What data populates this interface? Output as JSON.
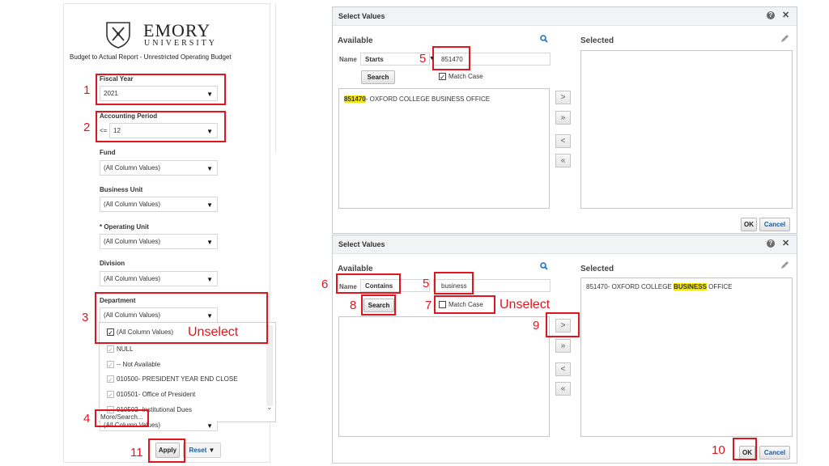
{
  "left": {
    "logo_name": "EMORY",
    "logo_sub": "UNIVERSITY",
    "report_title": "Budget to Actual Report - Unrestricted Operating Budget",
    "fiscal_year": {
      "label": "Fiscal Year",
      "value": "2021"
    },
    "accounting_period": {
      "label": "Accounting Period",
      "op": "<=",
      "value": "12"
    },
    "fund": {
      "label": "Fund",
      "value": "(All Column Values)"
    },
    "business_unit": {
      "label": "Business Unit",
      "value": "(All Column Values)"
    },
    "operating_unit": {
      "label": "* Operating Unit",
      "value": "(All Column Values)"
    },
    "division": {
      "label": "Division",
      "value": "(All Column Values)"
    },
    "department": {
      "label": "Department",
      "value": "(All Column Values)",
      "list": [
        "(All Column Values)",
        "NULL",
        "-- Not Available",
        "010500- PRESIDENT YEAR END CLOSE",
        "010501- Office of President",
        "010502- Institutional Dues"
      ],
      "more_search": "More/Search...",
      "next_value": "(All Column Values)"
    },
    "apply_label": "Apply",
    "reset_label": "Reset"
  },
  "dialog1": {
    "title": "Select Values",
    "available_label": "Available",
    "selected_label": "Selected",
    "name_label": "Name",
    "operator": "Starts",
    "search_value": "851470",
    "search_button": "Search",
    "match_case_label": "Match Case",
    "result_code": "851470",
    "result_rest": "- OXFORD COLLEGE BUSINESS OFFICE",
    "move_buttons": [
      ">",
      "»",
      "<",
      "«"
    ],
    "ok_label": "OK",
    "cancel_label": "Cancel"
  },
  "dialog2": {
    "title": "Select Values",
    "available_label": "Available",
    "selected_label": "Selected",
    "name_label": "Name",
    "operator": "Contains",
    "search_value": "business",
    "search_button": "Search",
    "match_case_label": "Match Case",
    "selected_pre": "851470- OXFORD COLLEGE ",
    "selected_hl": "BUSINESS",
    "selected_post": " OFFICE",
    "move_buttons": [
      ">",
      "»",
      "<",
      "«"
    ],
    "ok_label": "OK",
    "cancel_label": "Cancel"
  },
  "annotations": {
    "n1": "1",
    "n2": "2",
    "n3": "3",
    "n4": "4",
    "n5a": "5",
    "n5b": "5",
    "n6": "6",
    "n7": "7",
    "n8": "8",
    "n9": "9",
    "n10": "10",
    "n11": "11",
    "unselect_1": "Unselect",
    "unselect_2": "Unselect",
    "color": "#e0161e"
  }
}
